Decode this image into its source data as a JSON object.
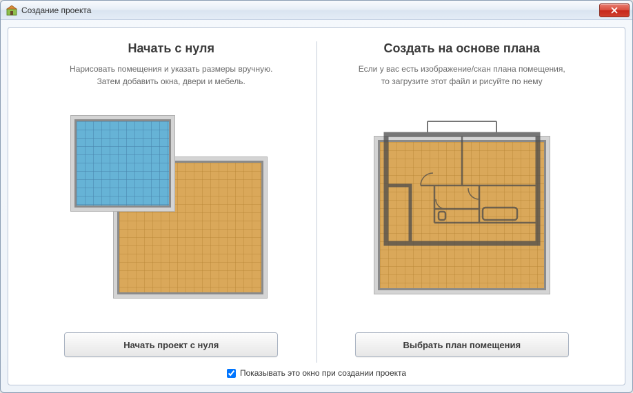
{
  "window": {
    "title": "Создание проекта"
  },
  "left": {
    "heading": "Начать с нуля",
    "desc_line1": "Нарисовать помещения и указать размеры вручную.",
    "desc_line2": "Затем добавить окна, двери и мебель.",
    "button": "Начать проект с нуля"
  },
  "right": {
    "heading": "Создать на основе плана",
    "desc_line1": "Если у вас есть изображение/скан плана помещения,",
    "desc_line2": "то загрузите этот файл и рисуйте по нему",
    "button": "Выбрать план помещения"
  },
  "footer": {
    "checkbox_label": "Показывать это окно при создании проекта",
    "checked": true
  },
  "colors": {
    "orange_fill": "#daa85a",
    "blue_fill": "#66b3d6",
    "border_gray": "#8a8a8a"
  }
}
